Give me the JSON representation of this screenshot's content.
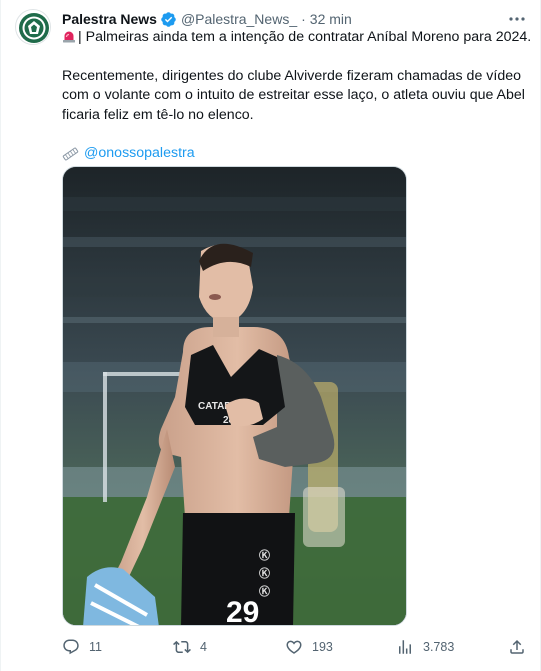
{
  "post": {
    "author_name": "Palestra News",
    "author_handle": "@Palestra_News_",
    "separator": "·",
    "time": "32 min",
    "text_line_1": "| Palmeiras ainda tem a intenção de contratar Aníbal Moreno para 2024.",
    "text_line_2": "Recentemente, dirigentes do clube Alviverde fizeram chamadas de vídeo",
    "text_line_3": "com o volante com o intuito de estreitar esse laço, o atleta ouviu que Abel",
    "text_line_4": "ficaria feliz em tê-lo no elenco.",
    "mention": "@onossopalestra"
  },
  "image": {
    "shirt_sponsor": "CATAPU",
    "chest_number": "28",
    "shorts_number": "29"
  },
  "actions": {
    "replies": "11",
    "reposts": "4",
    "likes": "193",
    "views": "3.783"
  },
  "icons": {
    "verified": "verified-badge-icon",
    "more": "more-horizontal-icon",
    "siren": "rotating-light-icon",
    "link": "link-icon",
    "reply": "reply-icon",
    "repost": "repost-icon",
    "like": "heart-icon",
    "views": "analytics-icon",
    "share": "share-icon"
  },
  "colors": {
    "text": "#0f1419",
    "secondary": "#536471",
    "link": "#1d9bf0",
    "verified": "#1d9bf0",
    "avatar_green": "#1f6b4a"
  }
}
